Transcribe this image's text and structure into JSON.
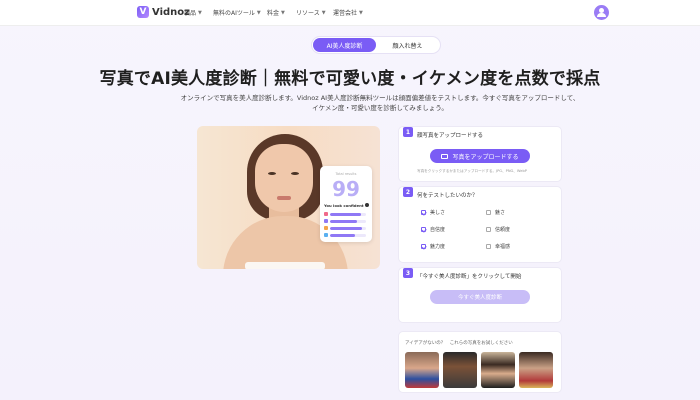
{
  "nav": {
    "logo_text": "Vidnoz",
    "logo_mark": "V",
    "items": [
      {
        "label": "製品"
      },
      {
        "label": "無料のAIツール"
      },
      {
        "label": "料金"
      },
      {
        "label": "リソース"
      },
      {
        "label": "運営会社"
      }
    ],
    "user_icon": "user-icon"
  },
  "tabs": [
    {
      "label": "AI美人度診断",
      "active": true
    },
    {
      "label": "顔入れ替え",
      "active": false
    }
  ],
  "hero": {
    "title": "写真でAI美人度診断｜無料で可愛い度・イケメン度を点数で採点",
    "subtitle": "オンラインで写真を美人度診断します。Vidnoz AI美人度診断無料ツールは顔面偏差値をテストします。今すぐ写真をアップロードして、イケメン度・可愛い度を診断してみましょう。"
  },
  "score_card": {
    "label": "Total results",
    "score": "99",
    "tag": "You look confident",
    "bars": [
      {
        "color": "#f06a8a",
        "level": 0.85
      },
      {
        "color": "#8f78f5",
        "level": 0.75
      },
      {
        "color": "#f3a54a",
        "level": 0.9
      },
      {
        "color": "#5ab0f0",
        "level": 0.7
      }
    ]
  },
  "steps": {
    "step1": {
      "number": "1",
      "title": "顔写真をアップロードする",
      "button": "写真をアップロードする",
      "hint": "写真をクリックするかまたはアップロードする。JPG、PNG、WebP"
    },
    "step2": {
      "number": "2",
      "title": "何をテストしたいのか？",
      "options": [
        {
          "label": "美しさ",
          "checked": true
        },
        {
          "label": "魅さ",
          "checked": false
        },
        {
          "label": "自信度",
          "checked": true
        },
        {
          "label": "信頼度",
          "checked": false
        },
        {
          "label": "魅力度",
          "checked": true
        },
        {
          "label": "幸福感",
          "checked": false
        }
      ]
    },
    "step3": {
      "number": "3",
      "title": "「今すぐ美人度診断」をクリックして開始",
      "button": "今すぐ美人度診断"
    }
  },
  "ideas": {
    "title": "アイデアがないの？　これらの写真をお試しください"
  }
}
